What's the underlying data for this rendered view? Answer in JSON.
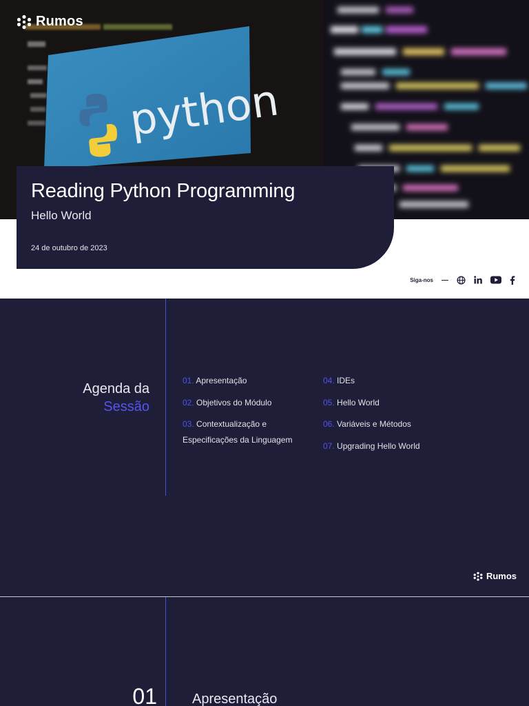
{
  "brand": {
    "name": "Rumos"
  },
  "cover": {
    "title": "Reading Python Programming",
    "subtitle": "Hello World",
    "date": "24 de outubro de 2023",
    "image_text": "python",
    "follow_label": "Siga-nos",
    "social_icons": [
      "globe-icon",
      "linkedin-icon",
      "youtube-icon",
      "facebook-icon"
    ]
  },
  "agenda": {
    "title_line1": "Agenda da",
    "title_line2": "Sessão",
    "items": [
      {
        "num": "01.",
        "label": "Apresentação"
      },
      {
        "num": "02.",
        "label": "Objetivos do Módulo"
      },
      {
        "num": "03.",
        "label": "Contextualização e",
        "label2": "Especificações da Linguagem"
      },
      {
        "num": "04.",
        "label": "IDEs"
      },
      {
        "num": "05.",
        "label": "Hello World"
      },
      {
        "num": "06.",
        "label": "Variáveis e Métodos"
      },
      {
        "num": "07.",
        "label": "Upgrading Hello World"
      }
    ]
  },
  "section": {
    "number": "01",
    "title": "Apresentação"
  },
  "colors": {
    "navy": "#1e1e38",
    "accent": "#5252ec",
    "white": "#ffffff"
  }
}
